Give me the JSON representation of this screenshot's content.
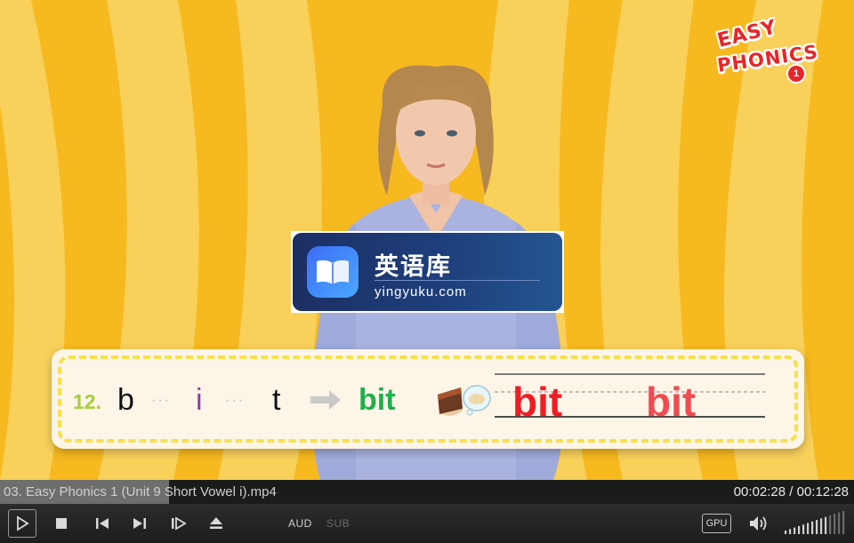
{
  "window": {
    "logo": {
      "line1": "EASY",
      "line2": "PHONICS",
      "badge": "1"
    }
  },
  "watermark": {
    "app_name": "英语库",
    "url": "yingyuku.com",
    "icon": "open-book-icon"
  },
  "lesson": {
    "number": "12.",
    "letters": [
      "b",
      "i",
      "t"
    ],
    "separator": "···",
    "result_word": "bit",
    "handwriting_word": "bit",
    "handwriting_word_2": "bit",
    "picture": "bitten-cake-icon",
    "colors": {
      "number": "#a8cf3b",
      "vowel": "#8c3da6",
      "word": "#1eb04a",
      "handwriting": "#ee1d24"
    }
  },
  "info_bar": {
    "filename": "03. Easy Phonics 1 (Unit 9 Short Vowel i).mp4",
    "timecode": "00:02:28 / 00:12:28",
    "progress_fraction": 0.198
  },
  "controls": {
    "buttons": [
      "play-icon",
      "stop-icon",
      "previous-icon",
      "next-icon",
      "frame-step-icon",
      "eject-icon"
    ],
    "audio_label": "AUD",
    "subtitle_label": "SUB",
    "gpu_label": "GPU",
    "volume_icon": "speaker-icon",
    "volume_level": 0.7
  },
  "colors": {
    "background": "#f6b91f",
    "stripe": "#f8d05a"
  }
}
